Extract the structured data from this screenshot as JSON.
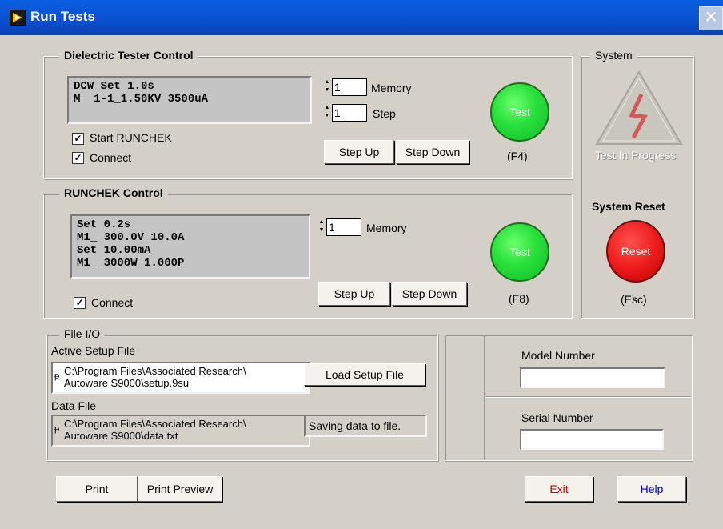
{
  "window": {
    "title": "Run Tests"
  },
  "dielectric": {
    "title": "Dielectric Tester Control",
    "display_line1": "DCW Set 1.0s",
    "display_line2": "M  1-1_1.50KV 3500uA",
    "memory_value": "1",
    "memory_label": "Memory",
    "step_value": "1",
    "step_label": "Step",
    "start_runchek_label": "Start RUNCHEK",
    "start_runchek_checked": true,
    "connect_label": "Connect",
    "connect_checked": true,
    "step_up": "Step Up",
    "step_down": "Step Down",
    "test_button": "Test",
    "test_hotkey": "(F4)"
  },
  "runchek": {
    "title": "RUNCHEK Control",
    "display_line1": "Set 0.2s",
    "display_line2": "M1_ 300.0V 10.0A",
    "display_line3": "Set 10.00mA",
    "display_line4": "M1_ 3000W 1.000P",
    "memory_value": "1",
    "memory_label": "Memory",
    "connect_label": "Connect",
    "connect_checked": true,
    "step_up": "Step Up",
    "step_down": "Step Down",
    "test_button": "Test",
    "test_hotkey": "(F8)"
  },
  "system": {
    "title": "System",
    "indicator_label": "Test In Progress",
    "reset_title": "System Reset",
    "reset_button": "Reset",
    "reset_hotkey": "(Esc)"
  },
  "file_io": {
    "title": "File I/O",
    "setup_label": "Active Setup File",
    "setup_path_line1": "C:\\Program Files\\Associated Research\\",
    "setup_path_line2": "Autoware S9000\\setup.9su",
    "load_button": "Load Setup File",
    "data_label": "Data File",
    "data_path_line1": "C:\\Program Files\\Associated Research\\",
    "data_path_line2": "Autoware S9000\\data.txt",
    "status_text": "Saving data to file."
  },
  "model": {
    "label": "Model Number",
    "value": ""
  },
  "serial": {
    "label": "Serial Number",
    "value": ""
  },
  "footer": {
    "print": "Print",
    "print_preview": "Print Preview",
    "exit": "Exit",
    "help": "Help"
  },
  "colors": {
    "test_green": "#27e03a",
    "reset_red": "#ee1c1c",
    "title_blue": "#0a55d6",
    "exit_text": "#cc0000",
    "help_text": "#0000cc"
  }
}
